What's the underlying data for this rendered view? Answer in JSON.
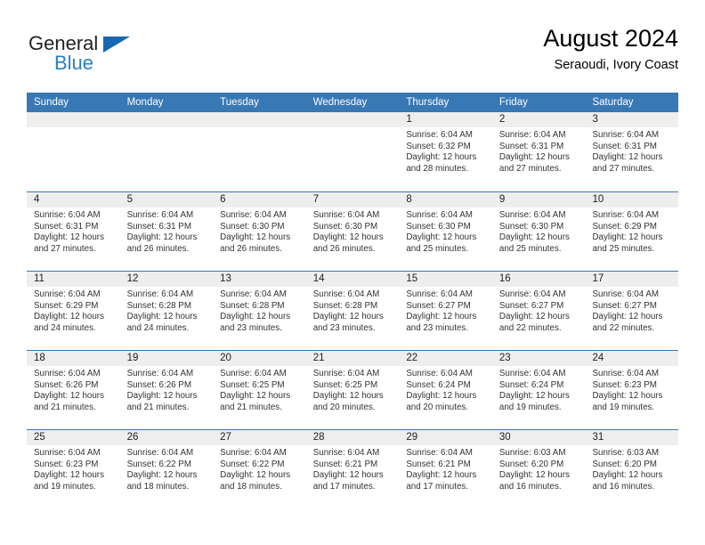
{
  "brand": {
    "name_top": "General",
    "name_bottom": "Blue",
    "accent_color": "#2a7fc1",
    "triangle_color": "#1668b0"
  },
  "header": {
    "title": "August 2024",
    "subtitle": "Seraoudi, Ivory Coast"
  },
  "calendar": {
    "header_color": "#3878b5",
    "daynum_strip_color": "#eeeeee",
    "day_names": [
      "Sunday",
      "Monday",
      "Tuesday",
      "Wednesday",
      "Thursday",
      "Friday",
      "Saturday"
    ],
    "weeks": [
      [
        {
          "day": "",
          "empty": true,
          "sunrise": "",
          "sunset": "",
          "daylight1": "",
          "daylight2": ""
        },
        {
          "day": "",
          "empty": true,
          "sunrise": "",
          "sunset": "",
          "daylight1": "",
          "daylight2": ""
        },
        {
          "day": "",
          "empty": true,
          "sunrise": "",
          "sunset": "",
          "daylight1": "",
          "daylight2": ""
        },
        {
          "day": "",
          "empty": true,
          "sunrise": "",
          "sunset": "",
          "daylight1": "",
          "daylight2": ""
        },
        {
          "day": "1",
          "empty": false,
          "sunrise": "Sunrise: 6:04 AM",
          "sunset": "Sunset: 6:32 PM",
          "daylight1": "Daylight: 12 hours",
          "daylight2": "and 28 minutes."
        },
        {
          "day": "2",
          "empty": false,
          "sunrise": "Sunrise: 6:04 AM",
          "sunset": "Sunset: 6:31 PM",
          "daylight1": "Daylight: 12 hours",
          "daylight2": "and 27 minutes."
        },
        {
          "day": "3",
          "empty": false,
          "sunrise": "Sunrise: 6:04 AM",
          "sunset": "Sunset: 6:31 PM",
          "daylight1": "Daylight: 12 hours",
          "daylight2": "and 27 minutes."
        }
      ],
      [
        {
          "day": "4",
          "empty": false,
          "sunrise": "Sunrise: 6:04 AM",
          "sunset": "Sunset: 6:31 PM",
          "daylight1": "Daylight: 12 hours",
          "daylight2": "and 27 minutes."
        },
        {
          "day": "5",
          "empty": false,
          "sunrise": "Sunrise: 6:04 AM",
          "sunset": "Sunset: 6:31 PM",
          "daylight1": "Daylight: 12 hours",
          "daylight2": "and 26 minutes."
        },
        {
          "day": "6",
          "empty": false,
          "sunrise": "Sunrise: 6:04 AM",
          "sunset": "Sunset: 6:30 PM",
          "daylight1": "Daylight: 12 hours",
          "daylight2": "and 26 minutes."
        },
        {
          "day": "7",
          "empty": false,
          "sunrise": "Sunrise: 6:04 AM",
          "sunset": "Sunset: 6:30 PM",
          "daylight1": "Daylight: 12 hours",
          "daylight2": "and 26 minutes."
        },
        {
          "day": "8",
          "empty": false,
          "sunrise": "Sunrise: 6:04 AM",
          "sunset": "Sunset: 6:30 PM",
          "daylight1": "Daylight: 12 hours",
          "daylight2": "and 25 minutes."
        },
        {
          "day": "9",
          "empty": false,
          "sunrise": "Sunrise: 6:04 AM",
          "sunset": "Sunset: 6:30 PM",
          "daylight1": "Daylight: 12 hours",
          "daylight2": "and 25 minutes."
        },
        {
          "day": "10",
          "empty": false,
          "sunrise": "Sunrise: 6:04 AM",
          "sunset": "Sunset: 6:29 PM",
          "daylight1": "Daylight: 12 hours",
          "daylight2": "and 25 minutes."
        }
      ],
      [
        {
          "day": "11",
          "empty": false,
          "sunrise": "Sunrise: 6:04 AM",
          "sunset": "Sunset: 6:29 PM",
          "daylight1": "Daylight: 12 hours",
          "daylight2": "and 24 minutes."
        },
        {
          "day": "12",
          "empty": false,
          "sunrise": "Sunrise: 6:04 AM",
          "sunset": "Sunset: 6:28 PM",
          "daylight1": "Daylight: 12 hours",
          "daylight2": "and 24 minutes."
        },
        {
          "day": "13",
          "empty": false,
          "sunrise": "Sunrise: 6:04 AM",
          "sunset": "Sunset: 6:28 PM",
          "daylight1": "Daylight: 12 hours",
          "daylight2": "and 23 minutes."
        },
        {
          "day": "14",
          "empty": false,
          "sunrise": "Sunrise: 6:04 AM",
          "sunset": "Sunset: 6:28 PM",
          "daylight1": "Daylight: 12 hours",
          "daylight2": "and 23 minutes."
        },
        {
          "day": "15",
          "empty": false,
          "sunrise": "Sunrise: 6:04 AM",
          "sunset": "Sunset: 6:27 PM",
          "daylight1": "Daylight: 12 hours",
          "daylight2": "and 23 minutes."
        },
        {
          "day": "16",
          "empty": false,
          "sunrise": "Sunrise: 6:04 AM",
          "sunset": "Sunset: 6:27 PM",
          "daylight1": "Daylight: 12 hours",
          "daylight2": "and 22 minutes."
        },
        {
          "day": "17",
          "empty": false,
          "sunrise": "Sunrise: 6:04 AM",
          "sunset": "Sunset: 6:27 PM",
          "daylight1": "Daylight: 12 hours",
          "daylight2": "and 22 minutes."
        }
      ],
      [
        {
          "day": "18",
          "empty": false,
          "sunrise": "Sunrise: 6:04 AM",
          "sunset": "Sunset: 6:26 PM",
          "daylight1": "Daylight: 12 hours",
          "daylight2": "and 21 minutes."
        },
        {
          "day": "19",
          "empty": false,
          "sunrise": "Sunrise: 6:04 AM",
          "sunset": "Sunset: 6:26 PM",
          "daylight1": "Daylight: 12 hours",
          "daylight2": "and 21 minutes."
        },
        {
          "day": "20",
          "empty": false,
          "sunrise": "Sunrise: 6:04 AM",
          "sunset": "Sunset: 6:25 PM",
          "daylight1": "Daylight: 12 hours",
          "daylight2": "and 21 minutes."
        },
        {
          "day": "21",
          "empty": false,
          "sunrise": "Sunrise: 6:04 AM",
          "sunset": "Sunset: 6:25 PM",
          "daylight1": "Daylight: 12 hours",
          "daylight2": "and 20 minutes."
        },
        {
          "day": "22",
          "empty": false,
          "sunrise": "Sunrise: 6:04 AM",
          "sunset": "Sunset: 6:24 PM",
          "daylight1": "Daylight: 12 hours",
          "daylight2": "and 20 minutes."
        },
        {
          "day": "23",
          "empty": false,
          "sunrise": "Sunrise: 6:04 AM",
          "sunset": "Sunset: 6:24 PM",
          "daylight1": "Daylight: 12 hours",
          "daylight2": "and 19 minutes."
        },
        {
          "day": "24",
          "empty": false,
          "sunrise": "Sunrise: 6:04 AM",
          "sunset": "Sunset: 6:23 PM",
          "daylight1": "Daylight: 12 hours",
          "daylight2": "and 19 minutes."
        }
      ],
      [
        {
          "day": "25",
          "empty": false,
          "sunrise": "Sunrise: 6:04 AM",
          "sunset": "Sunset: 6:23 PM",
          "daylight1": "Daylight: 12 hours",
          "daylight2": "and 19 minutes."
        },
        {
          "day": "26",
          "empty": false,
          "sunrise": "Sunrise: 6:04 AM",
          "sunset": "Sunset: 6:22 PM",
          "daylight1": "Daylight: 12 hours",
          "daylight2": "and 18 minutes."
        },
        {
          "day": "27",
          "empty": false,
          "sunrise": "Sunrise: 6:04 AM",
          "sunset": "Sunset: 6:22 PM",
          "daylight1": "Daylight: 12 hours",
          "daylight2": "and 18 minutes."
        },
        {
          "day": "28",
          "empty": false,
          "sunrise": "Sunrise: 6:04 AM",
          "sunset": "Sunset: 6:21 PM",
          "daylight1": "Daylight: 12 hours",
          "daylight2": "and 17 minutes."
        },
        {
          "day": "29",
          "empty": false,
          "sunrise": "Sunrise: 6:04 AM",
          "sunset": "Sunset: 6:21 PM",
          "daylight1": "Daylight: 12 hours",
          "daylight2": "and 17 minutes."
        },
        {
          "day": "30",
          "empty": false,
          "sunrise": "Sunrise: 6:03 AM",
          "sunset": "Sunset: 6:20 PM",
          "daylight1": "Daylight: 12 hours",
          "daylight2": "and 16 minutes."
        },
        {
          "day": "31",
          "empty": false,
          "sunrise": "Sunrise: 6:03 AM",
          "sunset": "Sunset: 6:20 PM",
          "daylight1": "Daylight: 12 hours",
          "daylight2": "and 16 minutes."
        }
      ]
    ]
  }
}
